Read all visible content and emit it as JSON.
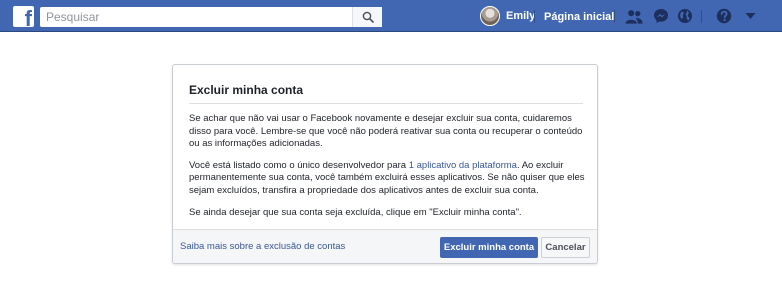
{
  "header": {
    "logo_icon": "facebook-logo-icon",
    "logo_letter": "f",
    "search": {
      "placeholder": "Pesquisar",
      "button_icon": "search-icon"
    },
    "profile": {
      "name": "Emily",
      "avatar_icon": "avatar"
    },
    "home_label": "Página inicial",
    "icons": [
      "friend-requests-icon",
      "messenger-icon",
      "notifications-globe-icon",
      "help-icon",
      "chevron-down-icon"
    ],
    "colors": {
      "bar": "#4267b2",
      "text": "#ffffff"
    }
  },
  "dialog": {
    "title": "Excluir minha conta",
    "paragraph1": "Se achar que não vai usar o Facebook novamente e desejar excluir sua conta, cuidaremos disso para você. Lembre-se que você não poderá reativar sua conta ou recuperar o conteúdo ou as informações adicionadas.",
    "paragraph2_before": "Você está listado como o único desenvolvedor para ",
    "paragraph2_link": "1 aplicativo da plataforma",
    "paragraph2_after": ". Ao excluir permanentemente sua conta, você também excluirá esses aplicativos. Se não quiser que eles sejam excluídos, transfira a propriedade dos aplicativos antes de excluir sua conta.",
    "paragraph3": "Se ainda desejar que sua conta seja excluída, clique em \"Excluir minha conta\".",
    "footer": {
      "learn_more": "Saiba mais sobre a exclusão de contas",
      "primary_button": "Excluir minha conta",
      "cancel_button": "Cancelar"
    },
    "colors": {
      "link": "#385898",
      "primary": "#4267b2"
    }
  }
}
